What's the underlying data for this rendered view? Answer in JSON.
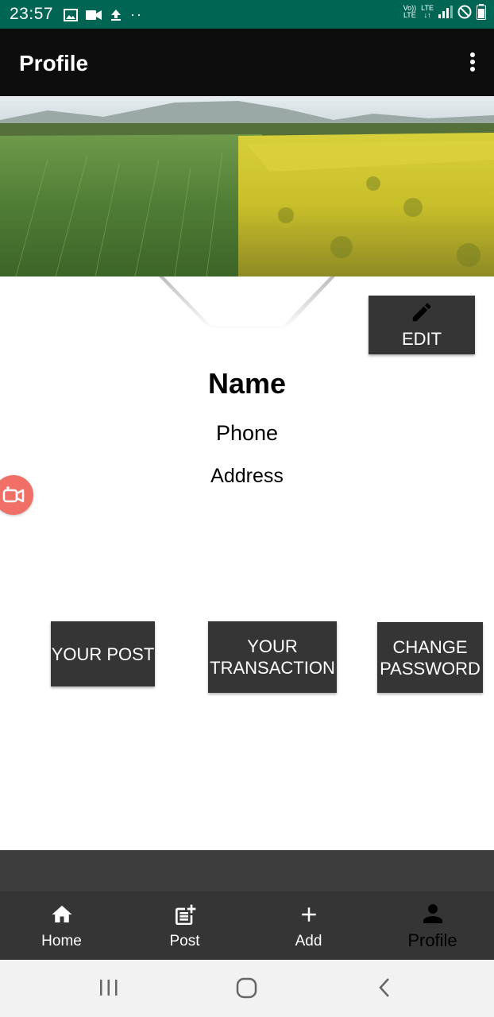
{
  "status_bar": {
    "time": "23:57",
    "volte_top": "Vo))",
    "volte_bottom": "LTE",
    "lte_top": "LTE",
    "lte_bottom": "↓↑"
  },
  "app_bar": {
    "title": "Profile",
    "menu_icon": "more-vertical-icon"
  },
  "profile": {
    "name": "Name",
    "phone": "Phone",
    "address": "Address",
    "edit_label": "EDIT"
  },
  "actions": {
    "your_post": "YOUR POST",
    "your_transaction_line1": "YOUR",
    "your_transaction_line2": "TRANSACTION",
    "change_password_line1": "CHANGE",
    "change_password_line2": "PASSWORD"
  },
  "bottom_nav": {
    "items": [
      {
        "label": "Home",
        "icon": "home-icon"
      },
      {
        "label": "Post",
        "icon": "post-add-icon"
      },
      {
        "label": "Add",
        "icon": "plus-icon"
      },
      {
        "label": "Profile",
        "icon": "person-icon"
      }
    ]
  },
  "colors": {
    "status_bar": "#006653",
    "app_bar": "#0d0d0d",
    "button": "#353535",
    "bottom_nav": "#353535",
    "record_bubble": "#f07068"
  }
}
